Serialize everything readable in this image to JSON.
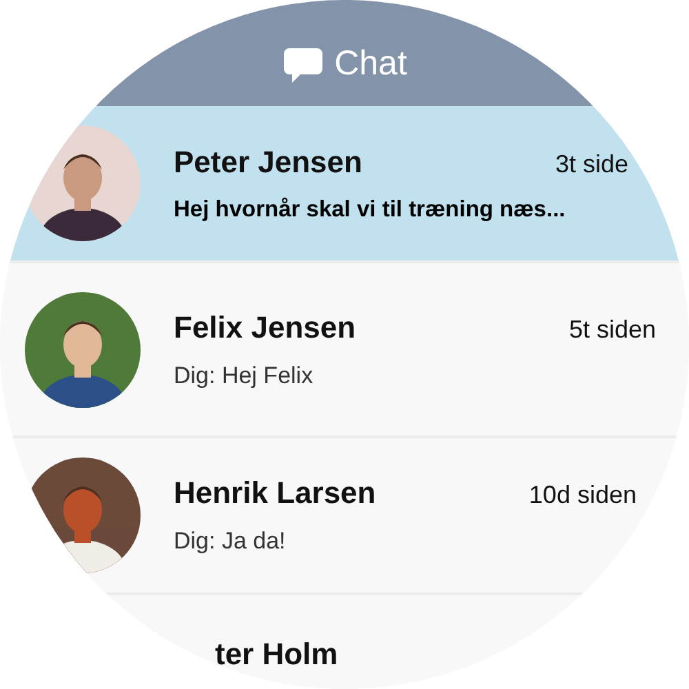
{
  "header": {
    "title": "Chat"
  },
  "conversations": [
    {
      "name": "Peter Jensen",
      "time": "3t side",
      "message": "Hej hvornår skal vi til træning næs...",
      "selected": true,
      "unread": true
    },
    {
      "name": "Felix Jensen",
      "time": "5t siden",
      "message": "Dig: Hej Felix",
      "selected": false,
      "unread": false
    },
    {
      "name": "Henrik Larsen",
      "time": "10d siden",
      "message": "Dig: Ja da!",
      "selected": false,
      "unread": false
    },
    {
      "name": "ter Holm",
      "selected": false
    }
  ]
}
